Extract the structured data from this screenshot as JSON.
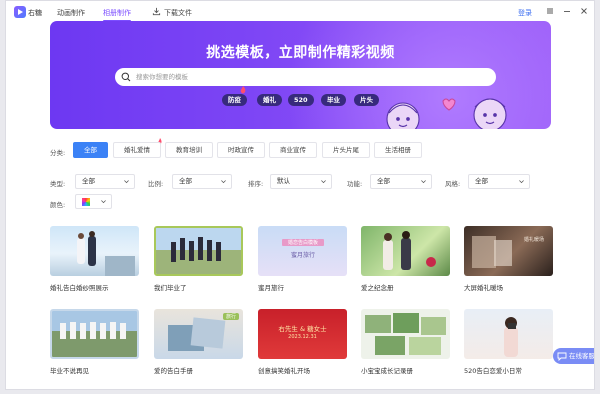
{
  "app": {
    "name": "右糖"
  },
  "nav": [
    {
      "label": "动画制作"
    },
    {
      "label": "相册制作"
    },
    {
      "label": "下载文件"
    }
  ],
  "header": {
    "login": "登录"
  },
  "banner": {
    "title": "挑选模板，立即制作精彩视频",
    "search_placeholder": "搜索你想要的模板",
    "tags": [
      "防疫",
      "婚礼",
      "520",
      "毕业",
      "片头"
    ]
  },
  "categories": {
    "label": "分类:",
    "items": [
      "全部",
      "婚礼爱情",
      "教育培训",
      "时政宣传",
      "商业宣传",
      "片头片尾",
      "生活相册"
    ],
    "active_index": 0
  },
  "filters": [
    {
      "label": "类型:",
      "value": "全部"
    },
    {
      "label": "比例:",
      "value": "全部"
    },
    {
      "label": "排序:",
      "value": "默认"
    },
    {
      "label": "功能:",
      "value": "全部"
    },
    {
      "label": "风格:",
      "value": "全部"
    }
  ],
  "color_filter": {
    "label": "颜色:"
  },
  "templates": [
    {
      "title": "婚礼告白婚纱照展示"
    },
    {
      "title": "我们毕业了"
    },
    {
      "title": "蜜月旅行",
      "thumb_text": [
        "婚恋告白模板",
        "蜜月旅行"
      ]
    },
    {
      "title": "爱之纪念册"
    },
    {
      "title": "大屏婚礼暖场",
      "thumb_text": [
        "婚礼暖场"
      ]
    },
    {
      "title": "毕业不说再见"
    },
    {
      "title": "爱的告白手册",
      "badge": "旅行"
    },
    {
      "title": "创意搞笑婚礼开场",
      "thumb_text": [
        "右先生 & 糖女士",
        "2023.12.31"
      ]
    },
    {
      "title": "小宝宝成长记录册"
    },
    {
      "title": "520告白恋爱小日常"
    }
  ],
  "service": {
    "label": "在线客服"
  },
  "colors": {
    "accent": "#7b4dff",
    "primary_blue": "#3b82f6",
    "banner_start": "#6d38f2",
    "banner_end": "#9b5cf8",
    "tag_bg": "#372a7d"
  }
}
